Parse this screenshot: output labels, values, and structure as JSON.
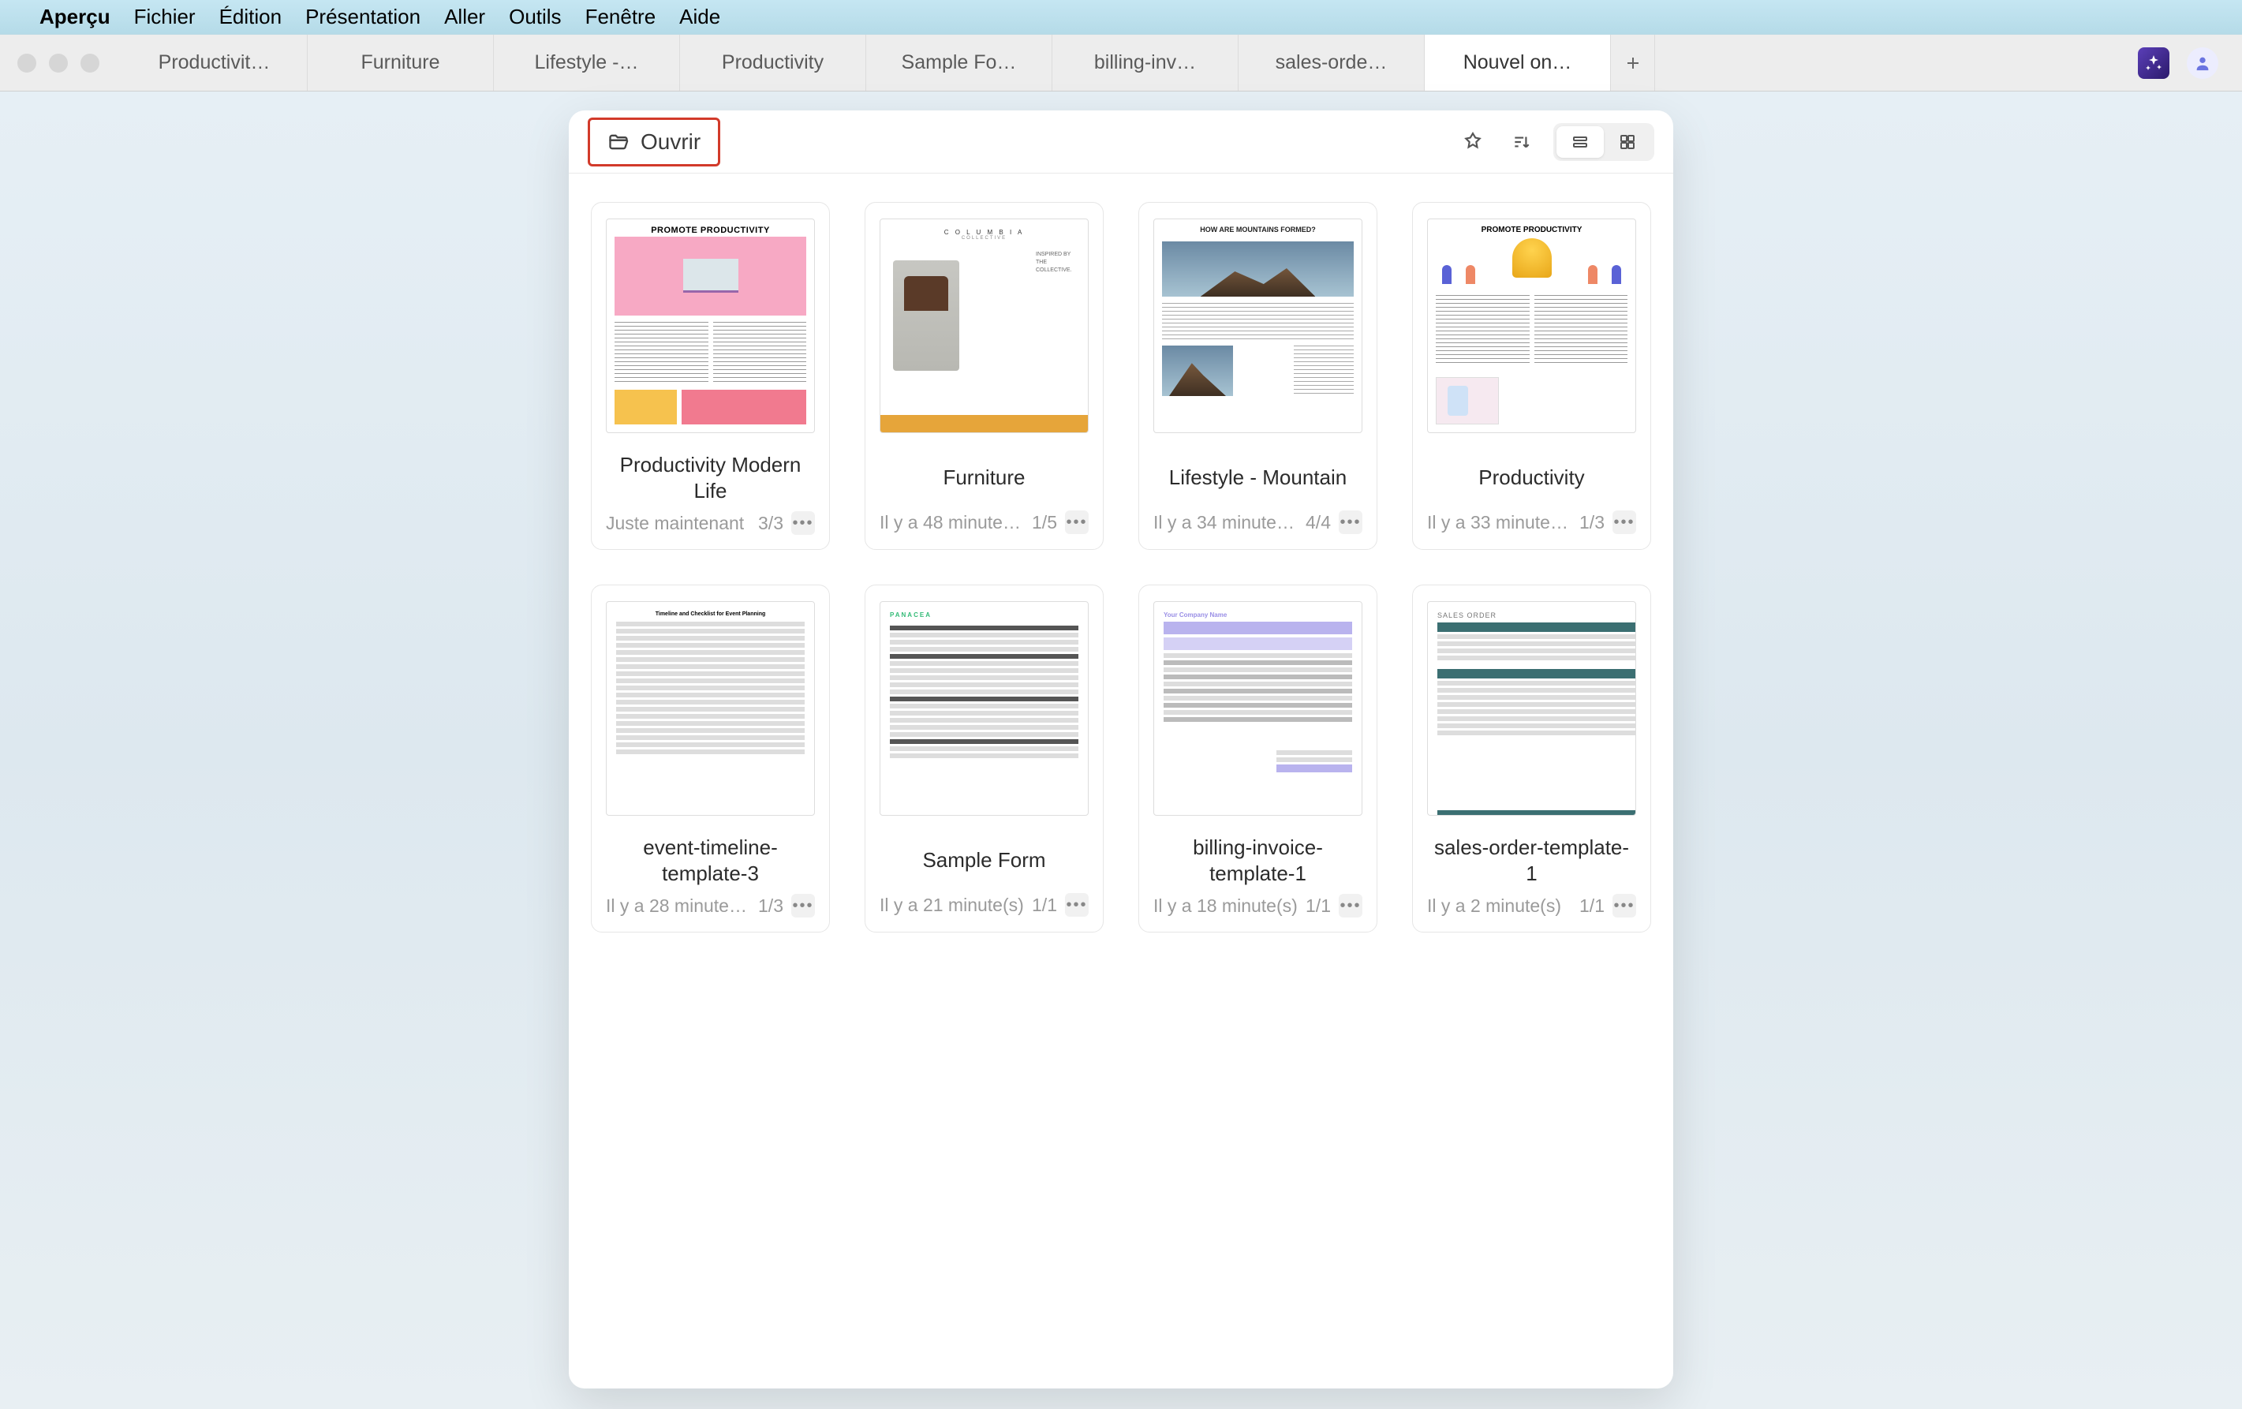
{
  "menubar": {
    "app_name": "Aperçu",
    "items": [
      "Fichier",
      "Édition",
      "Présentation",
      "Aller",
      "Outils",
      "Fenêtre",
      "Aide"
    ]
  },
  "tabs": [
    {
      "label": "Productivit…",
      "active": false
    },
    {
      "label": "Furniture",
      "active": false
    },
    {
      "label": "Lifestyle -…",
      "active": false
    },
    {
      "label": "Productivity",
      "active": false
    },
    {
      "label": "Sample Fo…",
      "active": false
    },
    {
      "label": "billing-inv…",
      "active": false
    },
    {
      "label": "sales-orde…",
      "active": false
    },
    {
      "label": "Nouvel on…",
      "active": true
    }
  ],
  "window": {
    "open_label": "Ouvrir"
  },
  "documents": [
    {
      "title": "Productivity Modern Life",
      "time": "Juste maintenant",
      "pages": "3/3",
      "thumb": "t1"
    },
    {
      "title": "Furniture",
      "time": "Il y a 48 minute…",
      "pages": "1/5",
      "thumb": "t2"
    },
    {
      "title": "Lifestyle - Mountain",
      "time": "Il y a 34 minute…",
      "pages": "4/4",
      "thumb": "t3"
    },
    {
      "title": "Productivity",
      "time": "Il y a 33 minute…",
      "pages": "1/3",
      "thumb": "t4"
    },
    {
      "title": "event-timeline-template-3",
      "time": "Il y a 28 minute…",
      "pages": "1/3",
      "thumb": "t5"
    },
    {
      "title": "Sample Form",
      "time": "Il y a 21 minute(s)",
      "pages": "1/1",
      "thumb": "t6"
    },
    {
      "title": "billing-invoice-template-1",
      "time": "Il y a 18 minute(s)",
      "pages": "1/1",
      "thumb": "t7"
    },
    {
      "title": "sales-order-template-1",
      "time": "Il y a 2 minute(s)",
      "pages": "1/1",
      "thumb": "t8"
    }
  ],
  "thumb_text": {
    "t1_hdr": "PROMOTE PRODUCTIVITY",
    "t2_brand": "C O L U M B I A",
    "t2_sub": "COLLECTIVE",
    "t2_side": "INSPIRED BY THE COLLECTIVE.",
    "t3_title": "HOW ARE MOUNTAINS FORMED?",
    "t4_hdr": "PROMOTE PRODUCTIVITY",
    "t5_title": "Timeline and Checklist for Event Planning",
    "t6_brand": "PANACEA",
    "t7_brand": "Your Company Name",
    "t8_brand": "SALES ORDER"
  }
}
